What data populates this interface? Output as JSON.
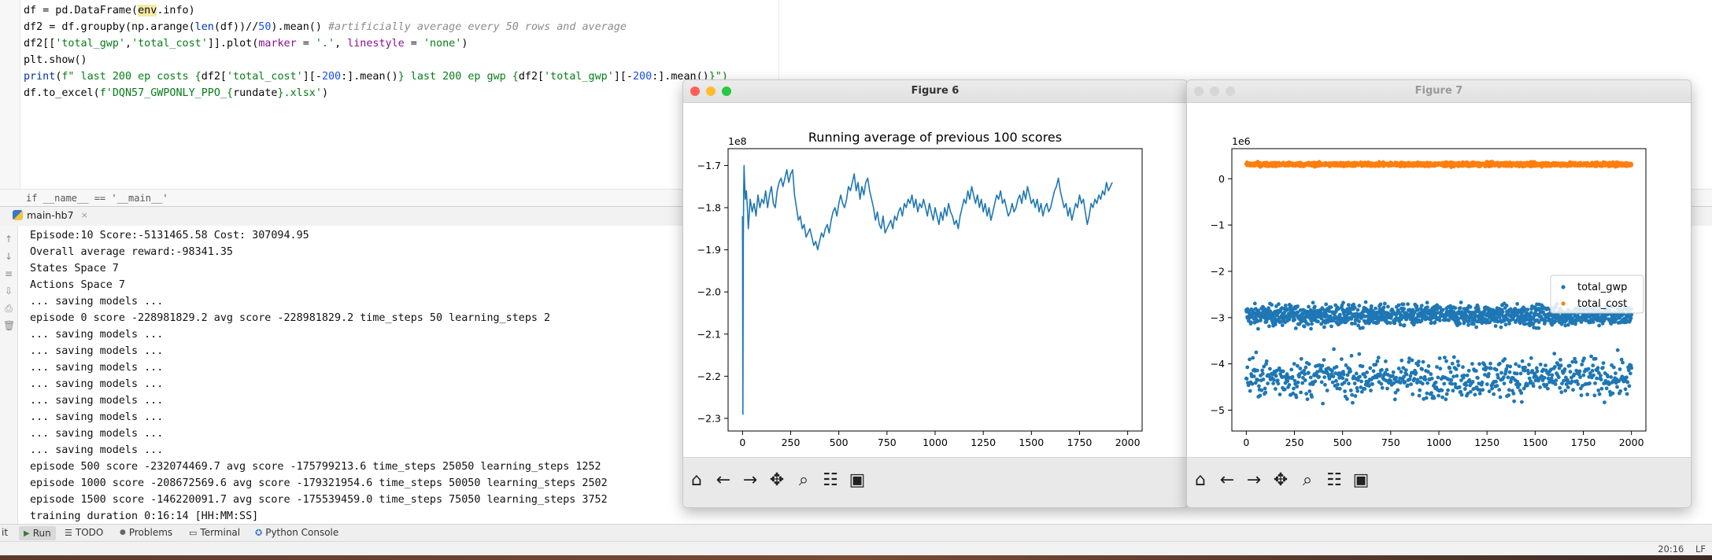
{
  "editor": {
    "lines": [
      {
        "segs": [
          {
            "t": "df = pd.DataFrame(",
            "c": ""
          },
          {
            "t": "env",
            "c": "kw-hl"
          },
          {
            "t": ".info)",
            "c": ""
          }
        ]
      },
      {
        "segs": [
          {
            "t": "df2 = df.groupby(np.arange(",
            "c": ""
          },
          {
            "t": "len",
            "c": "kw-bi"
          },
          {
            "t": "(df))//",
            "c": ""
          },
          {
            "t": "50",
            "c": "kw-num"
          },
          {
            "t": ").mean() ",
            "c": ""
          },
          {
            "t": "#artificially average every 50 rows and average",
            "c": "kw-cm"
          }
        ]
      },
      {
        "segs": [
          {
            "t": "df2[[",
            "c": ""
          },
          {
            "t": "'total_gwp'",
            "c": "kw-str"
          },
          {
            "t": ",",
            "c": ""
          },
          {
            "t": "'total_cost'",
            "c": "kw-str"
          },
          {
            "t": "]].plot(",
            "c": ""
          },
          {
            "t": "marker",
            "c": "kw-attr"
          },
          {
            "t": " = ",
            "c": ""
          },
          {
            "t": "'.'",
            "c": "kw-str"
          },
          {
            "t": ", ",
            "c": ""
          },
          {
            "t": "linestyle",
            "c": "kw-attr"
          },
          {
            "t": " = ",
            "c": ""
          },
          {
            "t": "'none'",
            "c": "kw-str"
          },
          {
            "t": ")",
            "c": ""
          }
        ]
      },
      {
        "segs": [
          {
            "t": "plt.show()",
            "c": ""
          }
        ]
      },
      {
        "segs": [
          {
            "t": "print",
            "c": "kw-bi"
          },
          {
            "t": "(",
            "c": ""
          },
          {
            "t": "f\" last 200 ep costs {",
            "c": "kw-str"
          },
          {
            "t": "df2[",
            "c": ""
          },
          {
            "t": "'total_cost'",
            "c": "kw-str"
          },
          {
            "t": "][-",
            "c": ""
          },
          {
            "t": "200",
            "c": "kw-num"
          },
          {
            "t": ":].mean()",
            "c": ""
          },
          {
            "t": "} last 200 ep gwp {",
            "c": "kw-str"
          },
          {
            "t": "df2[",
            "c": ""
          },
          {
            "t": "'total_gwp'",
            "c": "kw-str"
          },
          {
            "t": "][-",
            "c": ""
          },
          {
            "t": "200",
            "c": "kw-num"
          },
          {
            "t": ":].mean()",
            "c": ""
          },
          {
            "t": "}\")",
            "c": "kw-str"
          }
        ]
      },
      {
        "segs": [
          {
            "t": "df.to_excel(",
            "c": ""
          },
          {
            "t": "f'DQN57_GWPONLY_PPO_{",
            "c": "kw-str"
          },
          {
            "t": "rundate",
            "c": ""
          },
          {
            "t": "}.xlsx'",
            "c": "kw-str"
          },
          {
            "t": ")",
            "c": ""
          }
        ]
      }
    ],
    "breadcrumb": "if __name__ == '__main__'"
  },
  "run": {
    "tab_label": "main-hb7",
    "close_glyph": "×",
    "console_lines": [
      "Episode:10 Score:-5131465.58 Cost: 307094.95",
      "Overall average reward:-98341.35",
      "States Space 7",
      "Actions Space 7",
      "... saving models ...",
      "episode 0 score -228981829.2 avg score -228981829.2 time_steps 50 learning_steps 2",
      "... saving models ...",
      "... saving models ...",
      "... saving models ...",
      "... saving models ...",
      "... saving models ...",
      "... saving models ...",
      "... saving models ...",
      "... saving models ...",
      "episode 500 score -232074469.7 avg score -175799213.6 time_steps 25050 learning_steps 1252",
      "episode 1000 score -208672569.6 avg score -179321954.6 time_steps 50050 learning_steps 2502",
      "episode 1500 score -146220091.7 avg score -175539459.0 time_steps 75050 learning_steps 3752",
      "training duration 0:16:14 [HH:MM:SS]"
    ]
  },
  "bottom_tabs": [
    {
      "label": "it",
      "icon": ""
    },
    {
      "label": "Run",
      "icon": "▶"
    },
    {
      "label": "TODO",
      "icon": "☰"
    },
    {
      "label": "Problems",
      "icon": "●"
    },
    {
      "label": "Terminal",
      "icon": "▭"
    },
    {
      "label": "Python Console",
      "icon": "✪"
    }
  ],
  "status": {
    "time": "20:16",
    "line_sep": "LF"
  },
  "colors": {
    "line": "#1f77b4",
    "series1": "#1f77b4",
    "series2": "#ff7f0e",
    "close": "#fe5f57",
    "minimize": "#febc2e",
    "maximize": "#28c840",
    "inactive": "#d6d6d6"
  },
  "toolbar_icons": [
    "home-icon",
    "back-arrow-icon",
    "forward-arrow-icon",
    "pan-icon",
    "zoom-icon",
    "configure-subplots-icon",
    "save-icon"
  ],
  "fig6": {
    "window_title": "Figure 6",
    "chart_data": {
      "type": "line",
      "title": "Running average of previous 100 scores",
      "scale_label": "1e8",
      "xlim": [
        -75,
        2075
      ],
      "ylim": [
        -2.33,
        -1.66
      ],
      "xticks": [
        0,
        250,
        500,
        750,
        1000,
        1250,
        1500,
        1750,
        2000
      ],
      "yticks": [
        -2.3,
        -2.2,
        -2.1,
        -2.0,
        -1.9,
        -1.8,
        -1.7
      ],
      "series": [
        {
          "x": [
            0,
            2,
            4,
            6,
            8,
            10,
            14,
            20,
            25,
            30,
            40,
            50,
            60,
            70,
            80,
            90,
            100,
            110,
            120,
            130,
            140,
            150,
            160,
            170,
            180,
            190,
            200,
            210,
            220,
            230,
            240,
            250,
            260,
            270,
            280,
            290,
            300,
            310,
            320,
            330,
            340,
            350,
            360,
            370,
            380,
            390,
            400,
            410,
            420,
            430,
            440,
            450,
            460,
            470,
            480,
            490,
            500,
            510,
            520,
            530,
            540,
            550,
            560,
            570,
            580,
            590,
            600,
            610,
            620,
            630,
            640,
            650,
            660,
            670,
            680,
            690,
            700,
            710,
            720,
            730,
            740,
            750,
            760,
            770,
            780,
            790,
            800,
            810,
            820,
            830,
            840,
            850,
            860,
            870,
            880,
            890,
            900,
            910,
            920,
            930,
            940,
            950,
            960,
            970,
            980,
            990,
            1000,
            1010,
            1020,
            1030,
            1040,
            1050,
            1060,
            1070,
            1080,
            1090,
            1100,
            1110,
            1120,
            1130,
            1140,
            1150,
            1160,
            1170,
            1180,
            1190,
            1200,
            1210,
            1220,
            1230,
            1240,
            1250,
            1260,
            1270,
            1280,
            1290,
            1300,
            1310,
            1320,
            1330,
            1340,
            1350,
            1360,
            1370,
            1380,
            1390,
            1400,
            1410,
            1420,
            1430,
            1440,
            1450,
            1460,
            1470,
            1480,
            1490,
            1500,
            1510,
            1520,
            1530,
            1540,
            1550,
            1560,
            1570,
            1580,
            1590,
            1600,
            1610,
            1620,
            1630,
            1640,
            1650,
            1660,
            1670,
            1680,
            1690,
            1700,
            1710,
            1720,
            1730,
            1740,
            1750,
            1760,
            1770,
            1780,
            1790,
            1800,
            1810,
            1820,
            1830,
            1840,
            1850,
            1860,
            1870,
            1880,
            1890,
            1900,
            1910,
            1920,
            1930,
            1940,
            1950,
            1960,
            1970,
            1980,
            1990,
            2000
          ],
          "y": [
            -1.82,
            -2.29,
            -1.9,
            -1.76,
            -1.7,
            -1.73,
            -1.78,
            -1.76,
            -1.8,
            -1.85,
            -1.78,
            -1.81,
            -1.79,
            -1.82,
            -1.77,
            -1.8,
            -1.78,
            -1.79,
            -1.76,
            -1.8,
            -1.77,
            -1.75,
            -1.79,
            -1.8,
            -1.76,
            -1.74,
            -1.73,
            -1.75,
            -1.73,
            -1.71,
            -1.74,
            -1.72,
            -1.71,
            -1.77,
            -1.8,
            -1.83,
            -1.82,
            -1.85,
            -1.84,
            -1.87,
            -1.86,
            -1.85,
            -1.87,
            -1.89,
            -1.88,
            -1.9,
            -1.88,
            -1.86,
            -1.87,
            -1.85,
            -1.84,
            -1.86,
            -1.83,
            -1.81,
            -1.8,
            -1.82,
            -1.79,
            -1.77,
            -1.79,
            -1.8,
            -1.78,
            -1.75,
            -1.76,
            -1.74,
            -1.72,
            -1.76,
            -1.74,
            -1.78,
            -1.75,
            -1.77,
            -1.74,
            -1.73,
            -1.76,
            -1.78,
            -1.8,
            -1.83,
            -1.81,
            -1.84,
            -1.85,
            -1.82,
            -1.86,
            -1.85,
            -1.84,
            -1.83,
            -1.85,
            -1.82,
            -1.83,
            -1.81,
            -1.8,
            -1.82,
            -1.79,
            -1.8,
            -1.78,
            -1.79,
            -1.77,
            -1.8,
            -1.78,
            -1.81,
            -1.79,
            -1.8,
            -1.78,
            -1.8,
            -1.82,
            -1.79,
            -1.81,
            -1.83,
            -1.8,
            -1.82,
            -1.84,
            -1.81,
            -1.83,
            -1.8,
            -1.82,
            -1.79,
            -1.81,
            -1.82,
            -1.84,
            -1.83,
            -1.85,
            -1.82,
            -1.8,
            -1.78,
            -1.79,
            -1.76,
            -1.78,
            -1.75,
            -1.77,
            -1.79,
            -1.77,
            -1.8,
            -1.78,
            -1.81,
            -1.79,
            -1.82,
            -1.8,
            -1.83,
            -1.81,
            -1.79,
            -1.77,
            -1.78,
            -1.76,
            -1.79,
            -1.78,
            -1.8,
            -1.82,
            -1.81,
            -1.79,
            -1.81,
            -1.8,
            -1.78,
            -1.77,
            -1.79,
            -1.76,
            -1.78,
            -1.75,
            -1.77,
            -1.79,
            -1.78,
            -1.8,
            -1.78,
            -1.81,
            -1.79,
            -1.82,
            -1.8,
            -1.79,
            -1.81,
            -1.8,
            -1.78,
            -1.76,
            -1.75,
            -1.73,
            -1.76,
            -1.78,
            -1.8,
            -1.79,
            -1.82,
            -1.8,
            -1.83,
            -1.81,
            -1.79,
            -1.8,
            -1.77,
            -1.79,
            -1.78,
            -1.81,
            -1.84,
            -1.82,
            -1.79,
            -1.8,
            -1.78,
            -1.79,
            -1.77,
            -1.78,
            -1.76,
            -1.77,
            -1.74,
            -1.76,
            -1.75,
            -1.74
          ]
        }
      ]
    }
  },
  "fig7": {
    "window_title": "Figure 7",
    "chart_data": {
      "type": "scatter",
      "scale_label": "1e6",
      "xlim": [
        -75,
        2075
      ],
      "ylim": [
        -5.45,
        0.65
      ],
      "xticks": [
        0,
        250,
        500,
        750,
        1000,
        1250,
        1500,
        1750,
        2000
      ],
      "yticks": [
        0,
        -1,
        -2,
        -3,
        -4,
        -5
      ],
      "legend_position": "center-right",
      "series": [
        {
          "name": "total_gwp",
          "bands": [
            {
              "center": -2.95,
              "spread": 0.22,
              "count": 1300
            },
            {
              "center": -4.3,
              "spread": 0.42,
              "count": 700
            }
          ]
        },
        {
          "name": "total_cost",
          "bands": [
            {
              "center": 0.31,
              "spread": 0.04,
              "count": 2000
            }
          ]
        }
      ]
    }
  }
}
